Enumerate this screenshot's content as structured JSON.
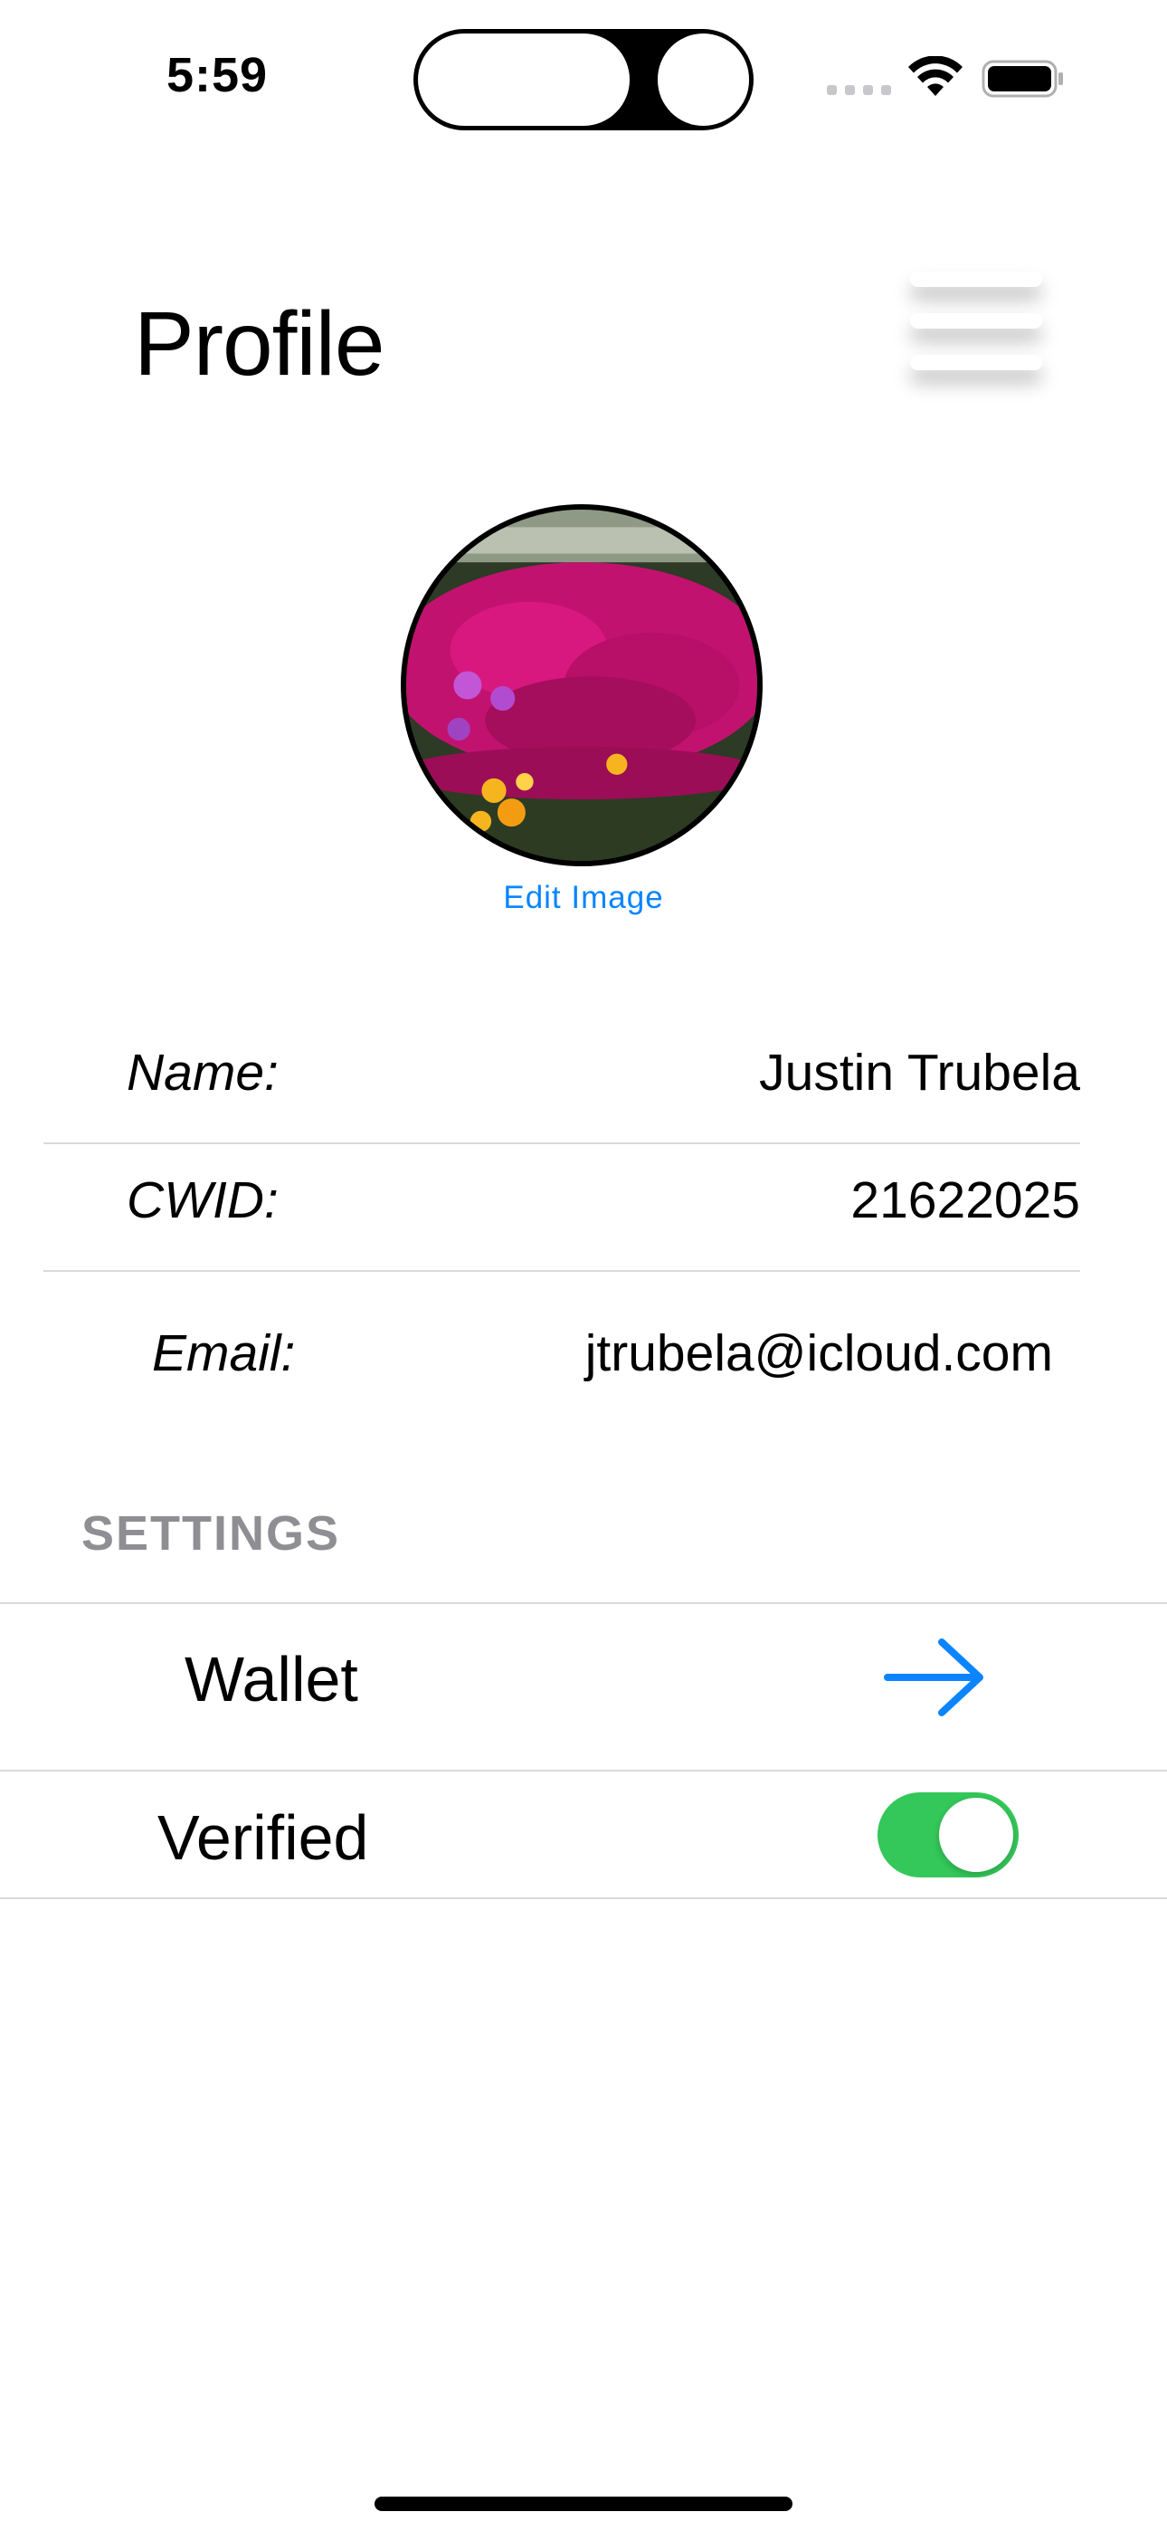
{
  "status_bar": {
    "time": "5:59"
  },
  "header": {
    "title": "Profile"
  },
  "profile": {
    "edit_image_label": "Edit Image"
  },
  "info": {
    "name_label": "Name:",
    "name_value": "Justin Trubela",
    "cwid_label": "CWID:",
    "cwid_value": "21622025",
    "email_label": "Email:",
    "email_value": "jtrubela@icloud.com"
  },
  "settings": {
    "header": "SETTINGS",
    "items": [
      {
        "label": "Wallet",
        "control": "arrow-right-icon"
      },
      {
        "label": "Verified",
        "control": "toggle",
        "on": true
      }
    ]
  },
  "colors": {
    "accent": "#0a84ff",
    "toggle_on": "#34c759",
    "section_header": "#8e8e93",
    "divider": "#dadada"
  }
}
